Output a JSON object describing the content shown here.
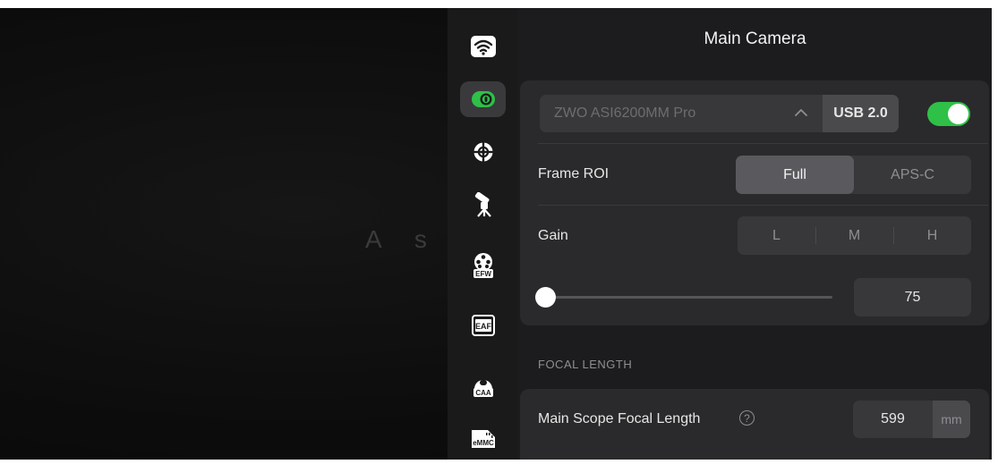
{
  "background": {
    "text": "A s   e"
  },
  "header": {
    "title": "Main Camera"
  },
  "rail": {
    "items": [
      {
        "icon": "wifi-icon",
        "label": ""
      },
      {
        "icon": "main-camera-icon",
        "label": "",
        "active": true
      },
      {
        "icon": "guide-target-icon",
        "label": ""
      },
      {
        "icon": "telescope-mount-icon",
        "label": ""
      },
      {
        "icon": "filter-wheel-icon",
        "label": "EFW"
      },
      {
        "icon": "focuser-icon",
        "label": "EAF"
      },
      {
        "icon": "rotator-icon",
        "label": "CAA"
      },
      {
        "icon": "storage-icon",
        "label": "eMMC"
      }
    ]
  },
  "camera": {
    "name": "ZWO ASI6200MM Pro",
    "connection": "USB 2.0",
    "enabled": true,
    "colors": {
      "toggle_on": "#2fc048"
    }
  },
  "frame_roi": {
    "label": "Frame ROI",
    "options": [
      "Full",
      "APS-C"
    ],
    "selected": "Full"
  },
  "gain": {
    "label": "Gain",
    "presets": [
      "L",
      "M",
      "H"
    ],
    "value": "75",
    "slider_fraction": 0.0
  },
  "focal_length": {
    "section_title": "FOCAL LENGTH",
    "label": "Main Scope Focal Length",
    "help_glyph": "?",
    "value": "599",
    "unit": "mm"
  }
}
